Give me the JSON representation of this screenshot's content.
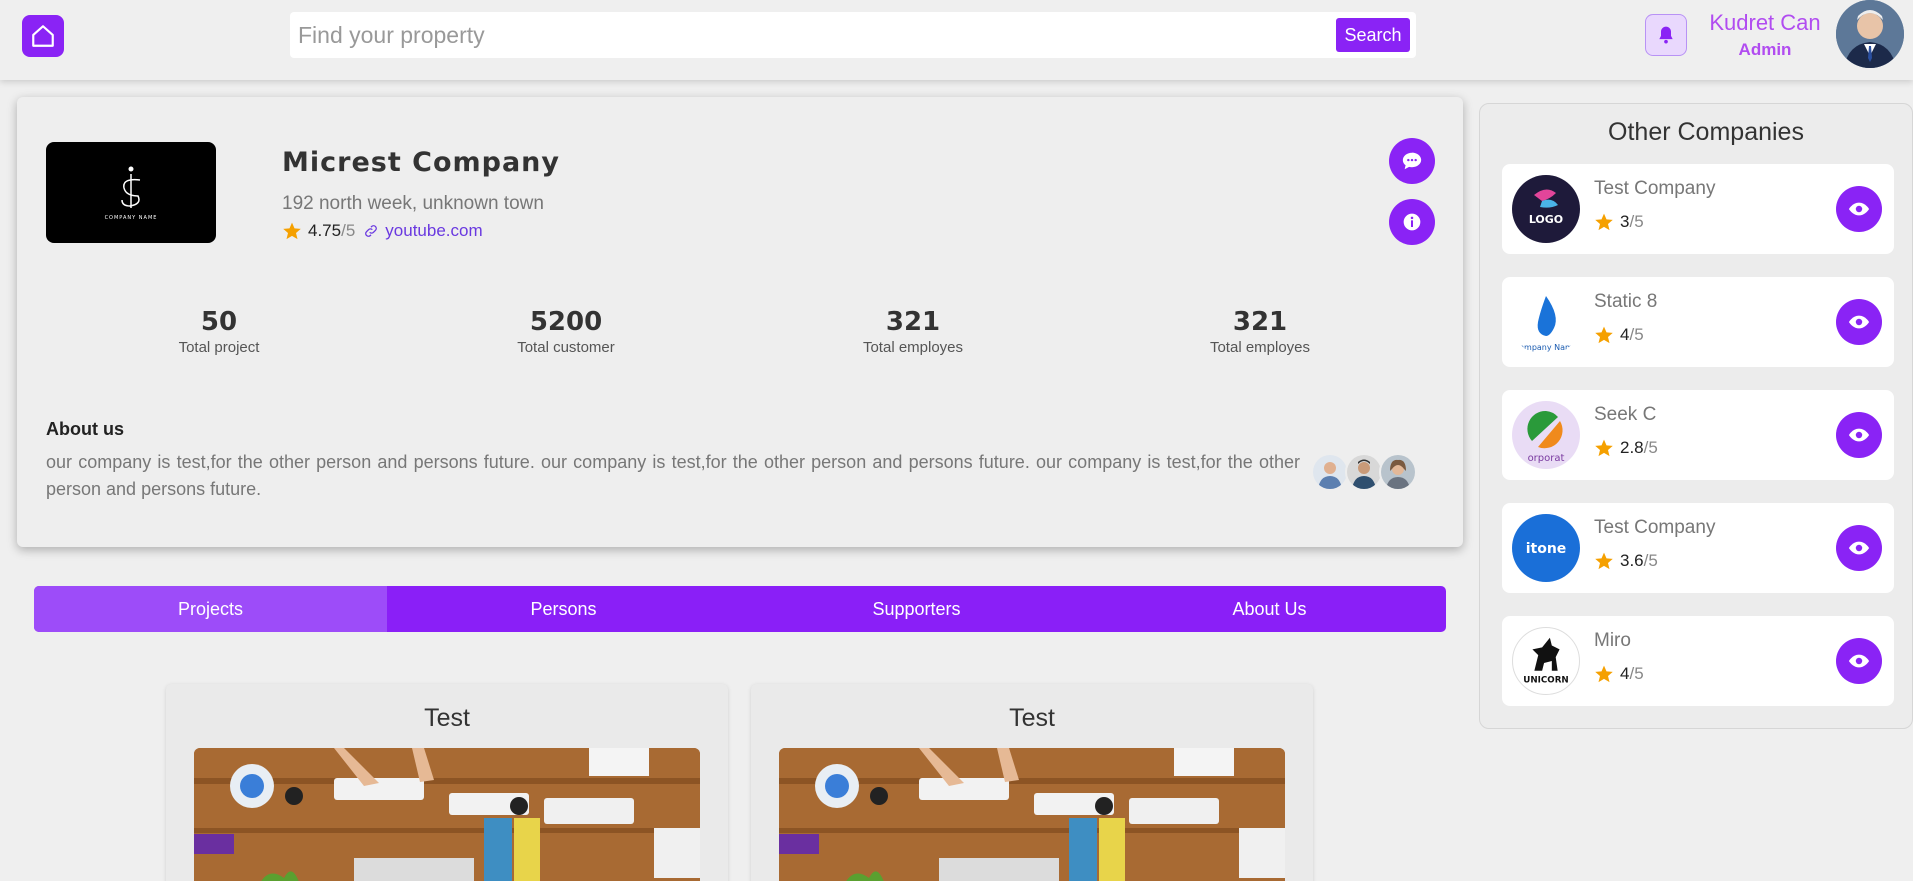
{
  "header": {
    "search_placeholder": "Find your property",
    "search_button": "Search",
    "user_name": "Kudret Can",
    "user_role": "Admin"
  },
  "company": {
    "name": "Micrest Company",
    "address": "192 north week, unknown town",
    "rating": "4.75",
    "rating_max": "/5",
    "link": "youtube.com",
    "logo_caption": "COMPANY NAME",
    "stats": [
      {
        "value": "50",
        "label": "Total project"
      },
      {
        "value": "5200",
        "label": "Total customer"
      },
      {
        "value": "321",
        "label": "Total employes"
      },
      {
        "value": "321",
        "label": "Total employes"
      }
    ],
    "about_title": "About us",
    "about_text": "our company is test,for the other person and persons future. our company is test,for the other person and persons future. our company is test,for the other person and persons future."
  },
  "tabs": [
    {
      "label": "Projects",
      "active": true
    },
    {
      "label": "Persons",
      "active": false
    },
    {
      "label": "Supporters",
      "active": false
    },
    {
      "label": "About Us",
      "active": false
    }
  ],
  "projects": [
    {
      "title": "Test"
    },
    {
      "title": "Test"
    }
  ],
  "other_companies": {
    "title": "Other Companies",
    "items": [
      {
        "name": "Test Company",
        "rating": "3",
        "rating_max": "/5",
        "logo_text": "LOGO"
      },
      {
        "name": "Static 8",
        "rating": "4",
        "rating_max": "/5",
        "logo_text": "ompany Nam"
      },
      {
        "name": "Seek C",
        "rating": "2.8",
        "rating_max": "/5",
        "logo_text": "orporat"
      },
      {
        "name": "Test Company",
        "rating": "3.6",
        "rating_max": "/5",
        "logo_text": "itone"
      },
      {
        "name": "Miro",
        "rating": "4",
        "rating_max": "/5",
        "logo_text": "UNICORN"
      }
    ]
  },
  "colors": {
    "accent": "#8a23f5",
    "star": "#f5a000",
    "user_text": "#b14cf0"
  }
}
